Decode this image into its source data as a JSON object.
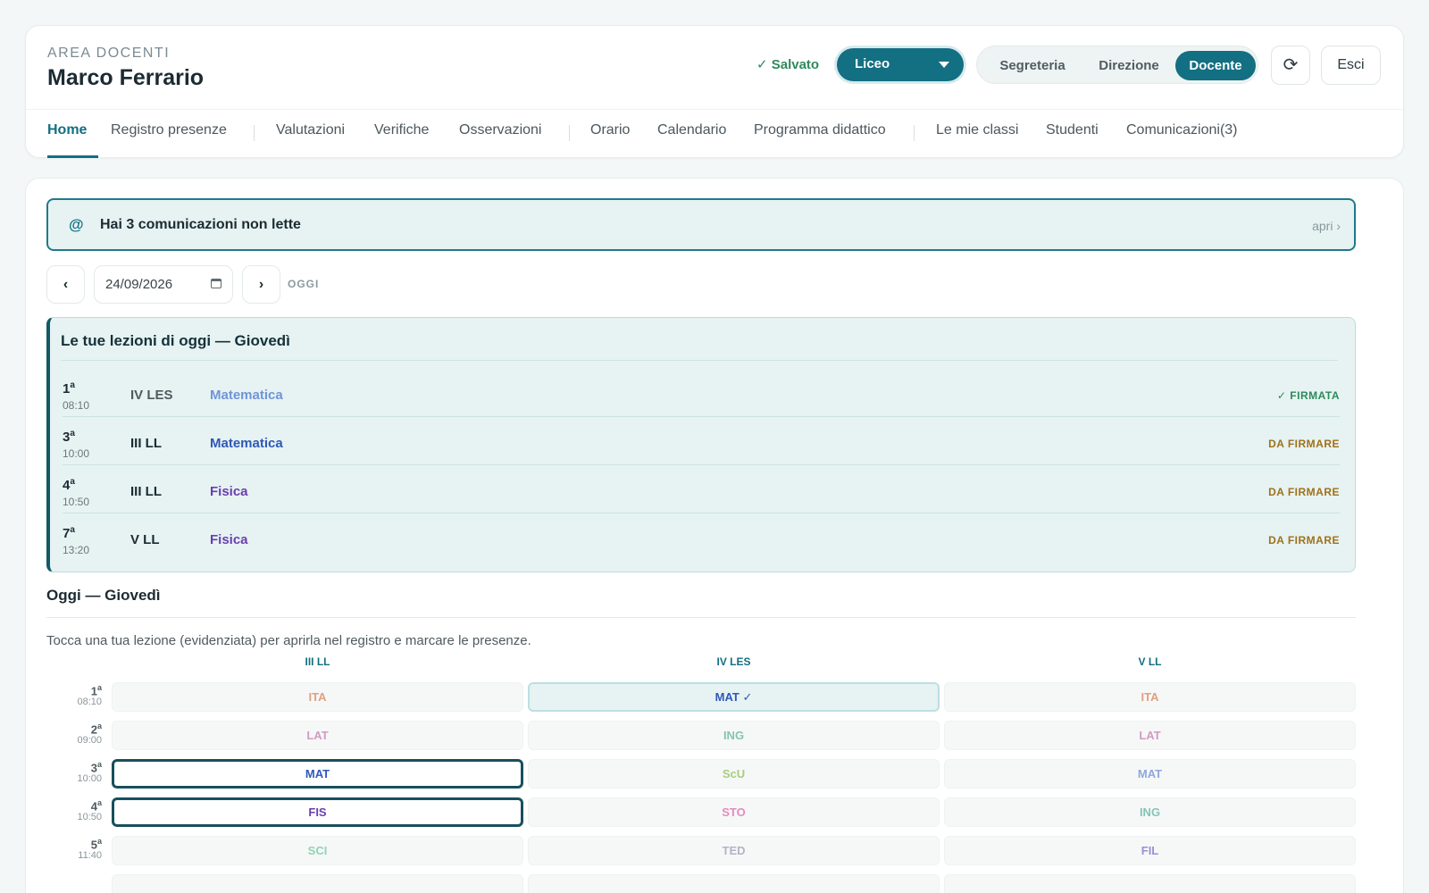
{
  "header": {
    "area_label": "AREA DOCENTI",
    "user_name": "Marco Ferrario",
    "saved_status": "✓ Salvato",
    "school_select": "Liceo",
    "roles": [
      {
        "label": "Segreteria",
        "active": false
      },
      {
        "label": "Direzione",
        "active": false
      },
      {
        "label": "Docente",
        "active": true
      }
    ],
    "refresh_icon": "⟳",
    "exit_label": "Esci"
  },
  "nav": {
    "items": [
      {
        "label": "Home",
        "active": true
      },
      {
        "label": "Registro presenze"
      },
      {
        "label": "Valutazioni"
      },
      {
        "label": "Verifiche"
      },
      {
        "label": "Osservazioni"
      },
      {
        "label": "Orario"
      },
      {
        "label": "Calendario"
      },
      {
        "label": "Programma didattico"
      },
      {
        "label": "Le mie classi"
      },
      {
        "label": "Studenti"
      },
      {
        "label": "Comunicazioni(3)"
      }
    ]
  },
  "notice": {
    "icon": "@",
    "text": "Hai 3 comunicazioni non lette",
    "open_label": "apri ›"
  },
  "date_nav": {
    "prev": "‹",
    "date": "24/09/2026",
    "next": "›",
    "today": "OGGI"
  },
  "lessons": {
    "title": "Le tue lezioni di oggi — Giovedì",
    "rows": [
      {
        "num": "1",
        "sup": "a",
        "time": "08:10",
        "class": "IV LES",
        "subject": "Matematica",
        "status": "✓ FIRMATA"
      },
      {
        "num": "3",
        "sup": "a",
        "time": "10:00",
        "class": "III LL",
        "subject": "Matematica",
        "status": "DA FIRMARE"
      },
      {
        "num": "4",
        "sup": "a",
        "time": "10:50",
        "class": "III LL",
        "subject": "Fisica",
        "status": "DA FIRMARE"
      },
      {
        "num": "7",
        "sup": "a",
        "time": "13:20",
        "class": "V LL",
        "subject": "Fisica",
        "status": "DA FIRMARE"
      }
    ]
  },
  "timetable": {
    "title": "Oggi — Giovedì",
    "hint": "Tocca una tua lezione (evidenziata) per aprirla nel registro e marcare le presenze.",
    "columns": [
      "III LL",
      "IV LES",
      "V LL"
    ],
    "rows": [
      {
        "num": "1",
        "sup": "a",
        "time": "08:10",
        "cells": [
          "ITA",
          "MAT ✓",
          "ITA"
        ]
      },
      {
        "num": "2",
        "sup": "a",
        "time": "09:00",
        "cells": [
          "LAT",
          "ING",
          "LAT"
        ]
      },
      {
        "num": "3",
        "sup": "a",
        "time": "10:00",
        "cells": [
          "MAT",
          "ScU",
          "MAT"
        ]
      },
      {
        "num": "4",
        "sup": "a",
        "time": "10:50",
        "cells": [
          "FIS",
          "STO",
          "ING"
        ]
      },
      {
        "num": "5",
        "sup": "a",
        "time": "11:40",
        "cells": [
          "SCI",
          "TED",
          "FIL"
        ]
      }
    ]
  },
  "colors": {
    "primary": "#136f82",
    "signed": "#2e8a5b",
    "to_sign": "#a0711a",
    "math": "#2f58b8",
    "physics": "#6a3fae"
  }
}
